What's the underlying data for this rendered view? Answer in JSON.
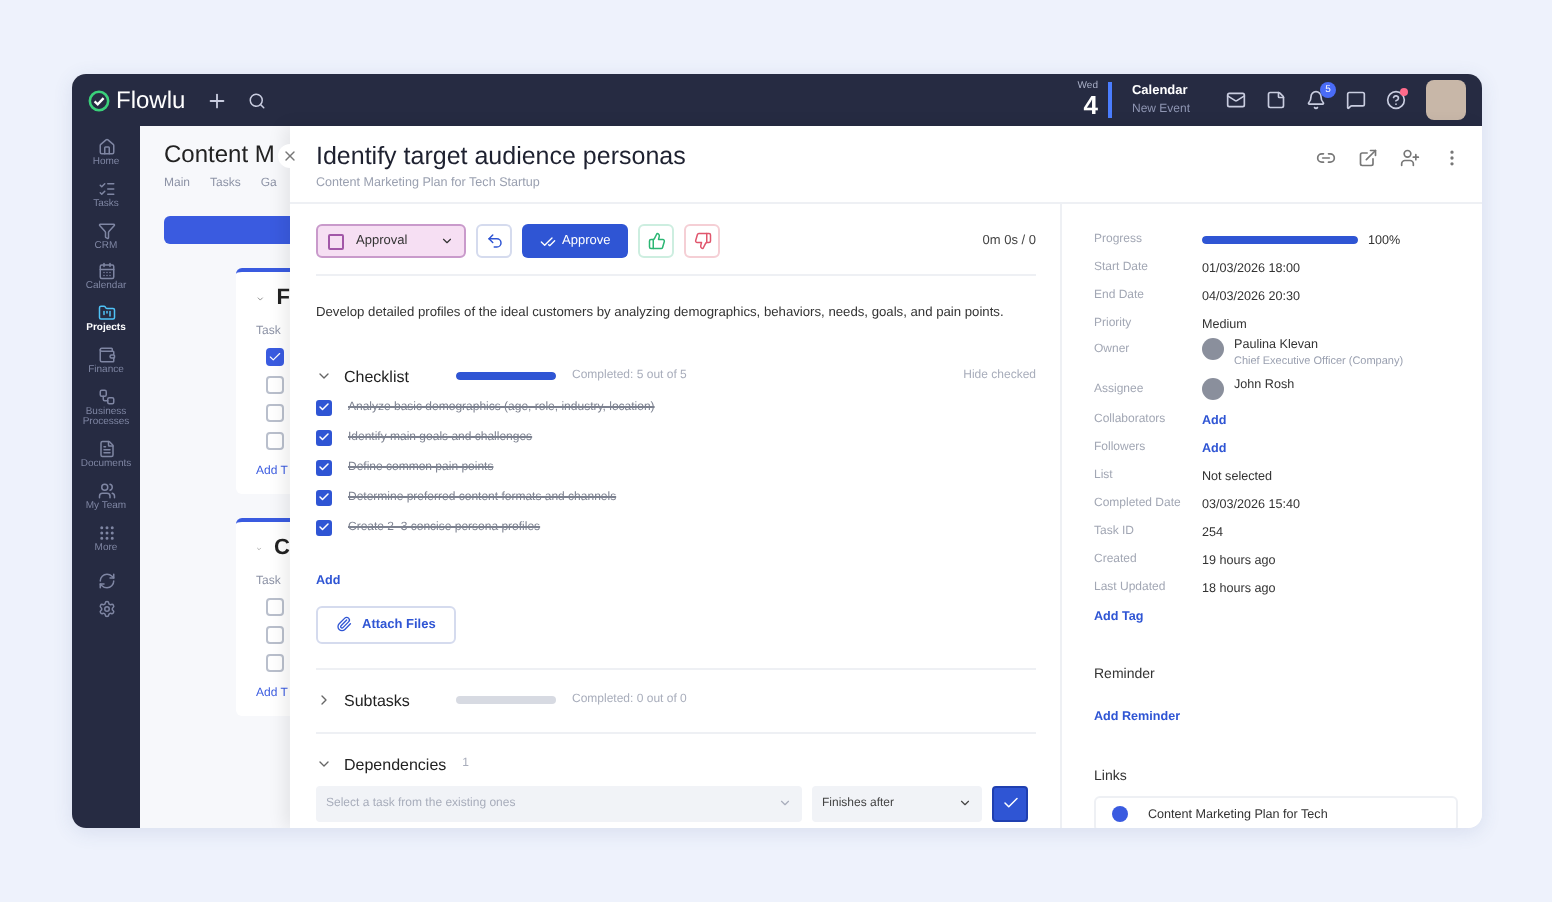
{
  "topbar": {
    "logo": "Flowlu",
    "date": {
      "weekday": "Wed",
      "day": "4"
    },
    "calendar": {
      "title": "Calendar",
      "subtitle": "New Event"
    },
    "notifications_badge": "5"
  },
  "sidebar": {
    "items": [
      {
        "label": "Home",
        "selected": false
      },
      {
        "label": "Tasks",
        "selected": false
      },
      {
        "label": "CRM",
        "selected": false
      },
      {
        "label": "Calendar",
        "selected": false
      },
      {
        "label": "Projects",
        "selected": true
      },
      {
        "label": "Finance",
        "selected": false
      },
      {
        "label": "Business Processes",
        "selected": false
      },
      {
        "label": "Documents",
        "selected": false
      },
      {
        "label": "My Team",
        "selected": false
      },
      {
        "label": "More",
        "selected": false
      }
    ]
  },
  "project": {
    "title": "Content M",
    "tabs": [
      "Main",
      "Tasks",
      "Ga"
    ],
    "cards": [
      {
        "heading": "F",
        "tasks_label": "Task",
        "checks": [
          true,
          false,
          false,
          false
        ],
        "add": "Add T"
      },
      {
        "heading": "C",
        "tasks_label": "Task",
        "checks": [
          false,
          false,
          false
        ],
        "add": "Add T"
      }
    ]
  },
  "task": {
    "title": "Identify target audience personas",
    "project": "Content Marketing Plan for Tech Startup",
    "status": "Approval",
    "approve": "Approve",
    "timer": "0m 0s / 0",
    "description": "Develop detailed profiles of the ideal customers by analyzing demographics, behaviors, needs, goals, and pain points.",
    "checklist": {
      "title": "Checklist",
      "expanded": true,
      "level": 1,
      "summary": "Completed: 5 out of 5",
      "hide": "Hide checked",
      "add": "Add",
      "items": [
        {
          "text": "Analyze basic demographics (age, role, industry, location)",
          "checked": true
        },
        {
          "text": "Identify main goals and challenges",
          "checked": true
        },
        {
          "text": "Define common pain points",
          "checked": true
        },
        {
          "text": "Determine preferred content formats and channels",
          "checked": true
        },
        {
          "text": "Create 2–3 concise persona profiles",
          "checked": true
        }
      ]
    },
    "attach": "Attach Files",
    "subtasks": {
      "title": "Subtasks",
      "expanded": false,
      "level": 0,
      "summary": "Completed: 0 out of 0"
    },
    "dependencies": {
      "title": "Dependencies",
      "expanded": true,
      "count": "1",
      "task_placeholder": "Select a task from the existing ones",
      "relation": "Finishes after"
    }
  },
  "details": {
    "progress": {
      "label": "Progress",
      "level": 1,
      "reading": "100%"
    },
    "fields": [
      {
        "label": "Start Date",
        "kind": "text",
        "value": "01/03/2026 18:00"
      },
      {
        "label": "End Date",
        "kind": "text",
        "value": "04/03/2026 20:30"
      },
      {
        "label": "Priority",
        "kind": "text",
        "value": "Medium"
      },
      {
        "label": "Owner",
        "kind": "person",
        "value": "Paulina Klevan",
        "subtitle": "Chief Executive Officer (Company)"
      },
      {
        "label": "Assignee",
        "kind": "person",
        "value": "John Rosh"
      },
      {
        "label": "Collaborators",
        "kind": "link",
        "value": "Add"
      },
      {
        "label": "Followers",
        "kind": "link",
        "value": "Add"
      },
      {
        "label": "List",
        "kind": "text",
        "value": "Not selected"
      },
      {
        "label": "Completed Date",
        "kind": "text",
        "value": "03/03/2026 15:40"
      },
      {
        "label": "Task ID",
        "kind": "text",
        "value": "254"
      },
      {
        "label": "Created",
        "kind": "text",
        "value": "19 hours ago"
      },
      {
        "label": "Last Updated",
        "kind": "text",
        "value": "18 hours ago"
      }
    ],
    "add_tag": "Add Tag",
    "reminder": {
      "title": "Reminder",
      "add": "Add Reminder"
    },
    "links": {
      "title": "Links",
      "items": [
        "Content Marketing Plan for Tech"
      ]
    }
  }
}
